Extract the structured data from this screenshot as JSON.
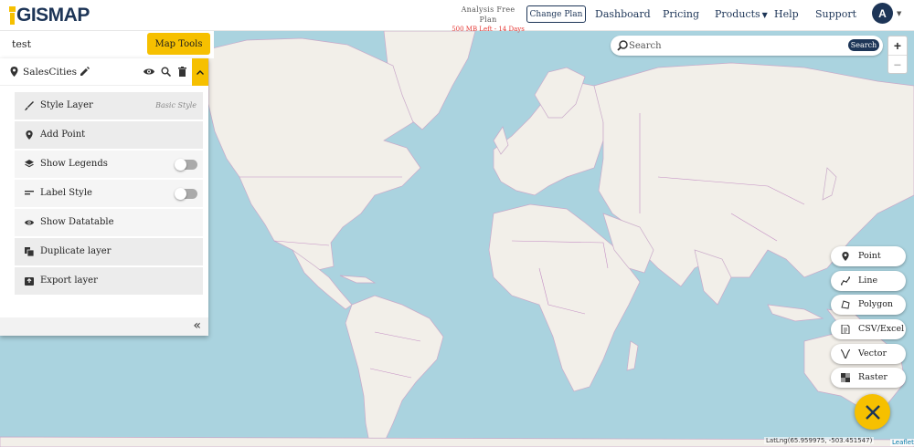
{
  "header": {
    "logo_text": "GISMAP",
    "plan_title": "Analysis Free Plan",
    "plan_sub": "500 MB Left - 14 Days",
    "change_plan_label": "Change Plan",
    "nav": {
      "dashboard": "Dashboard",
      "pricing": "Pricing",
      "products": "Products",
      "help": "Help",
      "support": "Support"
    },
    "avatar_initial": "A"
  },
  "project": {
    "name": "test",
    "map_tools_label": "Map Tools"
  },
  "layer": {
    "name": "SalesCities",
    "menu": [
      {
        "label": "Style Layer",
        "icon": "brush-icon",
        "extra": "Basic Style"
      },
      {
        "label": "Add Point",
        "icon": "map-pin-icon"
      },
      {
        "label": "Show Legends",
        "icon": "layers-icon",
        "toggle": false
      },
      {
        "label": "Label Style",
        "icon": "label-lines-icon",
        "toggle": false
      },
      {
        "label": "Show Datatable",
        "icon": "eye-icon"
      },
      {
        "label": "Duplicate layer",
        "icon": "duplicate-icon"
      },
      {
        "label": "Export layer",
        "icon": "export-icon"
      }
    ]
  },
  "search": {
    "placeholder": "Search",
    "button_label": "Search"
  },
  "zoom": {
    "in": "+",
    "out": "−"
  },
  "draw_tools": [
    {
      "label": "Point",
      "icon": "map-pin-icon"
    },
    {
      "label": "Line",
      "icon": "line-icon"
    },
    {
      "label": "Polygon",
      "icon": "polygon-icon"
    },
    {
      "label": "CSV/Excel",
      "icon": "file-icon"
    },
    {
      "label": "Vector",
      "icon": "vector-icon"
    },
    {
      "label": "Raster",
      "icon": "raster-icon"
    }
  ],
  "status": {
    "latlng": "LatLng(65.959975, -503.451547)",
    "attribution": "Leaflet"
  },
  "colors": {
    "accent": "#f6c000",
    "navy": "#1d3557",
    "water": "#aad3df",
    "land": "#f2efe9",
    "border": "#c48fc4"
  }
}
